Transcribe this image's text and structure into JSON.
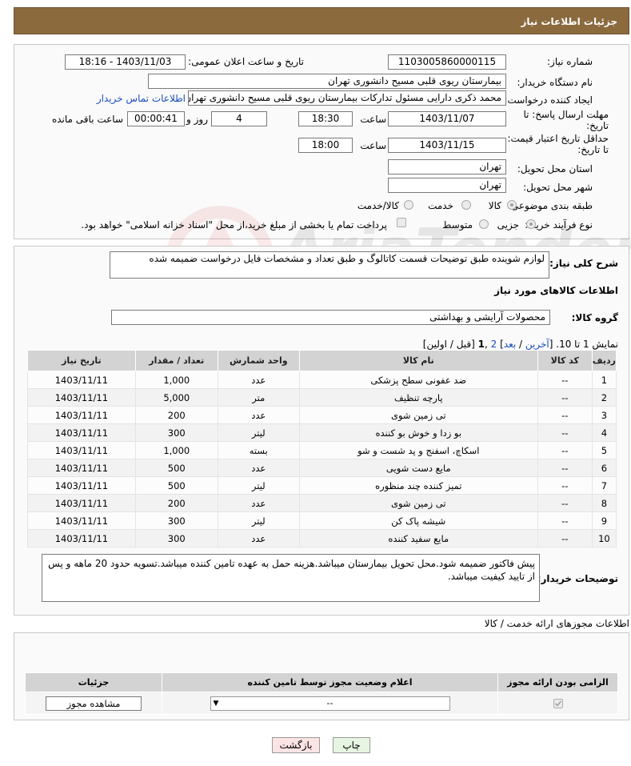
{
  "header": {
    "title": "جزئیات اطلاعات نیاز"
  },
  "form": {
    "need_number_label": "شماره نیاز:",
    "need_number": "1103005860000115",
    "announce_label": "تاریخ و ساعت اعلان عمومی:",
    "announce_value": "1403/11/03 - 18:16",
    "buyer_org_label": "نام دستگاه خریدار:",
    "buyer_org": "بیمارستان ریوی قلبی مسیح دانشوری تهران",
    "creator_label": "ایجاد کننده درخواست:",
    "creator": "محمد ذکری دارایی مسئول تدارکات بیمارستان ریوی قلبی مسیح دانشوری تهران",
    "contact_link": "اطلاعات تماس خریدار",
    "reply_deadline_label": "مهلت ارسال پاسخ: تا تاریخ:",
    "reply_date": "1403/11/07",
    "time_label": "ساعت",
    "reply_time": "18:30",
    "days_value": "4",
    "days_label": "روز و",
    "remaining_time": "00:00:41",
    "remaining_label": "ساعت باقی مانده",
    "validity_label": "حداقل تاریخ اعتبار قیمت: تا تاریخ:",
    "validity_date": "1403/11/15",
    "validity_time": "18:00",
    "province_label": "استان محل تحویل:",
    "province": "تهران",
    "city_label": "شهر محل تحویل:",
    "city": "تهران",
    "category_label": "طبقه بندی موضوعی:",
    "category_options": [
      "کالا",
      "خدمت",
      "کالا/خدمت"
    ],
    "process_label": "نوع فرآیند خرید :",
    "process_options": [
      "جزیی",
      "متوسط"
    ],
    "payment_note": "پرداخت تمام یا بخشی از مبلغ خرید،از محل \"اسناد خزانه اسلامی\" خواهد بود."
  },
  "summary": {
    "label": "شرح کلی نیاز:",
    "text": "لوازم شوینده طبق توضیحات قسمت کاتالوگ و طبق تعداد و مشخصات فایل درخواست ضمیمه شده",
    "goods_info_title": "اطلاعات کالاهای مورد نیاز",
    "goods_group_label": "گروه کالا:",
    "goods_group": "محصولات آرایشی و بهداشتی",
    "pagination": {
      "prefix": "نمایش 1 تا 10. [",
      "last": "آخرین",
      "sep1": " / ",
      "next": "بعد",
      "close": "] ",
      "page2": "2",
      "comma": " ,",
      "page1": "1",
      "suffix": " [قبل / اولین]"
    }
  },
  "items_table": {
    "headers": [
      "ردیف",
      "کد کالا",
      "نام کالا",
      "واحد شمارش",
      "تعداد / مقدار",
      "تاریخ نیاز"
    ],
    "rows": [
      [
        "1",
        "--",
        "ضد عفونی سطح پزشکی",
        "عدد",
        "1,000",
        "1403/11/11"
      ],
      [
        "2",
        "--",
        "پارچه تنظیف",
        "متر",
        "5,000",
        "1403/11/11"
      ],
      [
        "3",
        "--",
        "تی زمین شوی",
        "عدد",
        "200",
        "1403/11/11"
      ],
      [
        "4",
        "--",
        "بو زدا و خوش بو کننده",
        "لیتر",
        "300",
        "1403/11/11"
      ],
      [
        "5",
        "--",
        "اسکاچ، اسفنج و پد شست و شو",
        "بسته",
        "1,000",
        "1403/11/11"
      ],
      [
        "6",
        "--",
        "مایع دست شویی",
        "عدد",
        "500",
        "1403/11/11"
      ],
      [
        "7",
        "--",
        "تمیز کننده چند منظوره",
        "لیتر",
        "500",
        "1403/11/11"
      ],
      [
        "8",
        "--",
        "تی زمین شوی",
        "عدد",
        "200",
        "1403/11/11"
      ],
      [
        "9",
        "--",
        "شیشه پاک کن",
        "لیتر",
        "300",
        "1403/11/11"
      ],
      [
        "10",
        "--",
        "مایع سفید کننده",
        "عدد",
        "300",
        "1403/11/11"
      ]
    ]
  },
  "buyer_notes": {
    "label": "توضیحات خریدار:",
    "text": "پیش فاکتور ضمیمه شود.محل تحویل بیمارستان میباشد.هزینه حمل به عهده تامین کننده میباشد.تسویه حدود 20 ماهه و پس از تایید کیفیت میباشد."
  },
  "permits": {
    "title": "اطلاعات مجوزهای ارائه خدمت / کالا",
    "headers": [
      "الزامی بودن ارائه مجوز",
      "اعلام وضعیت مجوز توسط تامین کننده",
      "جزئیات"
    ],
    "select_value": "--",
    "view_button": "مشاهده مجوز"
  },
  "buttons": {
    "print": "چاپ",
    "back": "بازگشت"
  },
  "colors": {
    "header": "#8b6a3e",
    "link": "#1a4dbf",
    "back_button": "#fde4e4",
    "print_button": "#e6f5e1"
  }
}
